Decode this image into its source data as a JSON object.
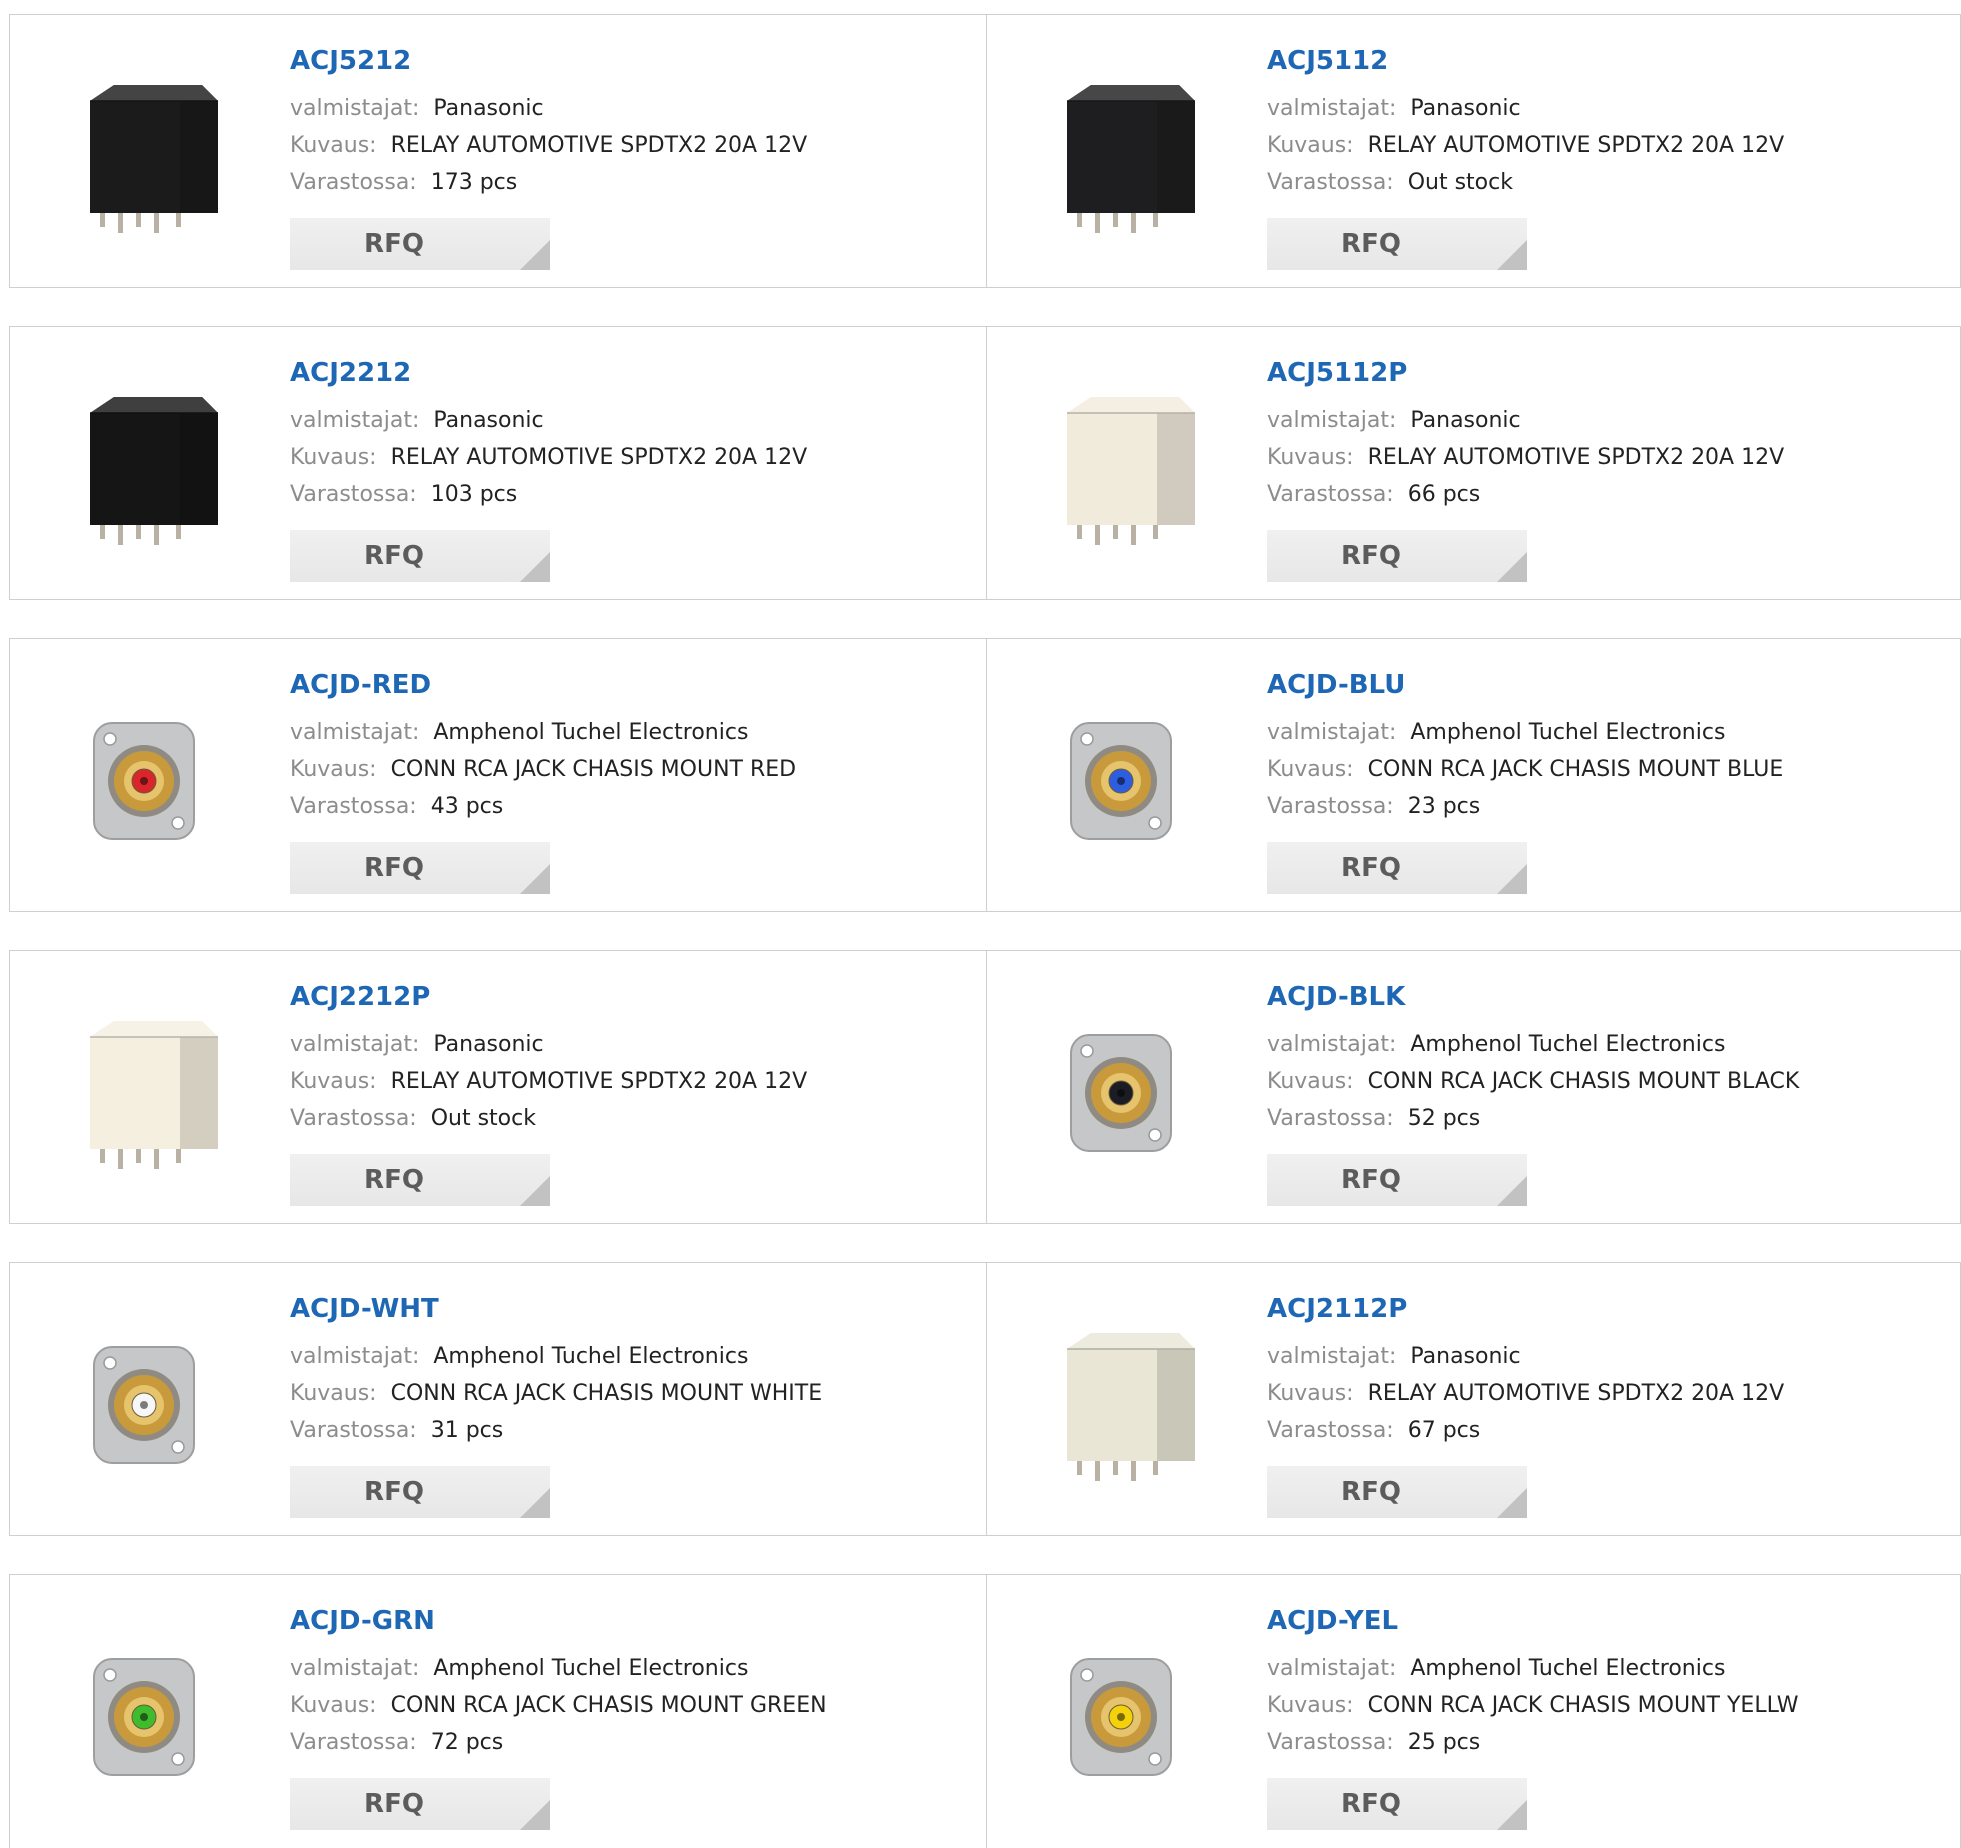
{
  "labels": {
    "manufacturer": "valmistajat:",
    "description": "Kuvaus:",
    "stock": "Varastossa:",
    "rfq": "RFQ"
  },
  "colors": {
    "link": "#1d67b5",
    "label": "#8c8c8c",
    "border": "#cfcfcf",
    "button_bg": "#ececec",
    "button_text": "#5c5c5c"
  },
  "products": [
    {
      "part": "ACJ5212",
      "manufacturer": "Panasonic",
      "description": "RELAY AUTOMOTIVE SPDTX2 20A 12V",
      "stock": "173 pcs",
      "image": "relay-black-icon",
      "color": "#1b1b1b"
    },
    {
      "part": "ACJ5112",
      "manufacturer": "Panasonic",
      "description": "RELAY AUTOMOTIVE SPDTX2 20A 12V",
      "stock": "Out stock",
      "image": "relay-black-icon",
      "color": "#1e1e20"
    },
    {
      "part": "ACJ2212",
      "manufacturer": "Panasonic",
      "description": "RELAY AUTOMOTIVE SPDTX2 20A 12V",
      "stock": "103 pcs",
      "image": "relay-black-icon",
      "color": "#151515"
    },
    {
      "part": "ACJ5112P",
      "manufacturer": "Panasonic",
      "description": "RELAY AUTOMOTIVE SPDTX2 20A 12V",
      "stock": "66 pcs",
      "image": "relay-white-icon",
      "color": "#f1ebdc"
    },
    {
      "part": "ACJD-RED",
      "manufacturer": "Amphenol Tuchel Electronics",
      "description": "CONN RCA JACK CHASIS MOUNT RED",
      "stock": "43 pcs",
      "image": "rca-jack-red-icon",
      "color": "#d8262b"
    },
    {
      "part": "ACJD-BLU",
      "manufacturer": "Amphenol Tuchel Electronics",
      "description": "CONN RCA JACK CHASIS MOUNT BLUE",
      "stock": "23 pcs",
      "image": "rca-jack-blue-icon",
      "color": "#2d5ee0"
    },
    {
      "part": "ACJ2212P",
      "manufacturer": "Panasonic",
      "description": "RELAY AUTOMOTIVE SPDTX2 20A 12V",
      "stock": "Out stock",
      "image": "relay-white-icon",
      "color": "#f5efe0"
    },
    {
      "part": "ACJD-BLK",
      "manufacturer": "Amphenol Tuchel Electronics",
      "description": "CONN RCA JACK CHASIS MOUNT BLACK",
      "stock": "52 pcs",
      "image": "rca-jack-black-icon",
      "color": "#1c1c24"
    },
    {
      "part": "ACJD-WHT",
      "manufacturer": "Amphenol Tuchel Electronics",
      "description": "CONN RCA JACK CHASIS MOUNT WHITE",
      "stock": "31 pcs",
      "image": "rca-jack-white-icon",
      "color": "#f7f7f7"
    },
    {
      "part": "ACJ2112P",
      "manufacturer": "Panasonic",
      "description": "RELAY AUTOMOTIVE SPDTX2 20A 12V",
      "stock": "67 pcs",
      "image": "relay-white-icon",
      "color": "#e9e6d6"
    },
    {
      "part": "ACJD-GRN",
      "manufacturer": "Amphenol Tuchel Electronics",
      "description": "CONN RCA JACK CHASIS MOUNT GREEN",
      "stock": "72 pcs",
      "image": "rca-jack-green-icon",
      "color": "#3fbb2e"
    },
    {
      "part": "ACJD-YEL",
      "manufacturer": "Amphenol Tuchel Electronics",
      "description": "CONN RCA JACK CHASIS MOUNT YELLW",
      "stock": "25 pcs",
      "image": "rca-jack-yellow-icon",
      "color": "#f4d20b"
    }
  ]
}
